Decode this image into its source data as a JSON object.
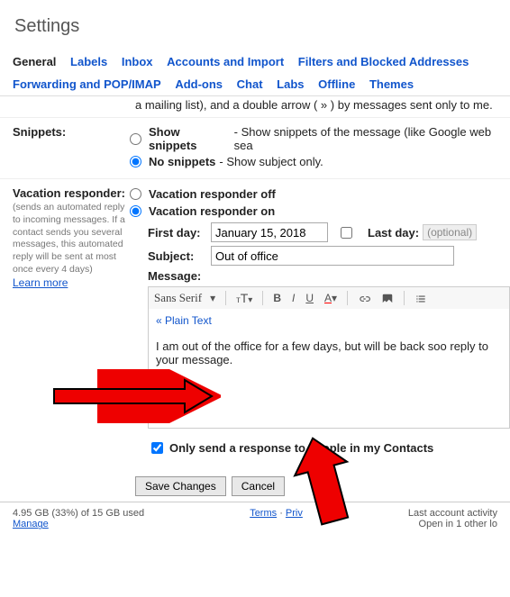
{
  "page_title": "Settings",
  "tabs": {
    "general": "General",
    "labels": "Labels",
    "inbox": "Inbox",
    "accounts": "Accounts and Import",
    "filters": "Filters and Blocked Addresses",
    "forwarding": "Forwarding and POP/IMAP",
    "addons": "Add-ons",
    "chat": "Chat",
    "labs": "Labs",
    "offline": "Offline",
    "themes": "Themes"
  },
  "cut_row": "a mailing list), and a double arrow ( » ) by messages sent only to me.",
  "snippets": {
    "label": "Snippets:",
    "show": "Show snippets",
    "show_desc": " - Show snippets of the message (like Google web sea",
    "no": "No snippets",
    "no_desc": " - Show subject only."
  },
  "vacation": {
    "label": "Vacation responder:",
    "sublabel": "(sends an automated reply to incoming messages. If a contact sends you several messages, this automated reply will be sent at most once every 4 days)",
    "learn_more": "Learn more",
    "off": "Vacation responder off",
    "on": "Vacation responder on",
    "first_day_label": "First day:",
    "first_day_value": "January 15, 2018",
    "last_day_label": "Last day:",
    "last_day_placeholder": "(optional)",
    "subject_label": "Subject:",
    "subject_value": "Out of office",
    "message_label": "Message:",
    "font_name": "Sans Serif",
    "plain_text": "« Plain Text",
    "message_body": "I am out of the office for a few days, but will be back soo reply to your message.",
    "contacts_only": "Only send a response to people in my Contacts"
  },
  "buttons": {
    "save": "Save Changes",
    "cancel": "Cancel"
  },
  "footer": {
    "storage": "4.95 GB (33%) of 15 GB used",
    "manage": "Manage",
    "terms": "Terms",
    "privacy": "Priv",
    "activity1": "Last account activity",
    "activity2": "Open in 1 other lo"
  }
}
